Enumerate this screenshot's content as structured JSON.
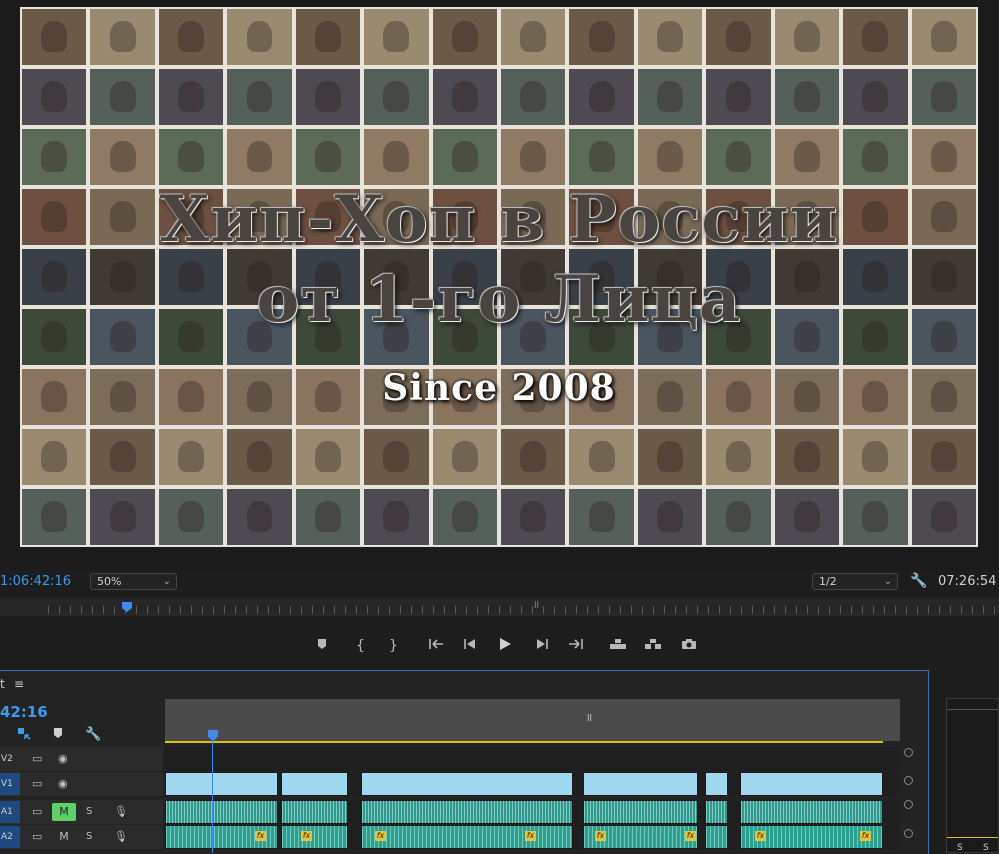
{
  "program_monitor": {
    "title_line1": "Хип-Хоп в России",
    "title_line2": "от 1-го Лица",
    "title_since": "Since 2008",
    "current_timecode": "1:06:42:16",
    "zoom": "50%",
    "resolution": "1/2",
    "duration_timecode": "07:26:54",
    "mini_center_mark": "ll"
  },
  "transport": {
    "add_marker": "marker-icon",
    "mark_in": "{",
    "mark_out": "}",
    "go_to_in": "go-to-in-icon",
    "step_back": "step-back-icon",
    "play": "play-icon",
    "step_forward": "step-forward-icon",
    "go_to_out": "go-to-out-icon",
    "lift": "lift-icon",
    "extract": "extract-icon",
    "export_frame": "camera-icon"
  },
  "timeline": {
    "tab_label": "t",
    "menu_glyph": "≡",
    "timecode": "42:16",
    "ruler_mark": "ll",
    "tracks": [
      {
        "name": "V2",
        "kind": "video"
      },
      {
        "name": "V1",
        "kind": "video"
      },
      {
        "name": "A1",
        "kind": "audio",
        "mute": "M",
        "solo": "S",
        "mute_active": true
      },
      {
        "name": "A2",
        "kind": "audio",
        "mute": "M",
        "solo": "S",
        "mute_active": false
      }
    ],
    "fx_label": "fx"
  },
  "side_panel": {
    "s1": "S",
    "s2": "S"
  },
  "colors": {
    "accent_blue": "#3d9af2",
    "video_clip": "#9fd8ef",
    "audio_clip": "#2f9a8c",
    "mute_active": "#5fcf6a",
    "fx_badge": "#e7c43a",
    "work_area": "#d6c600"
  }
}
